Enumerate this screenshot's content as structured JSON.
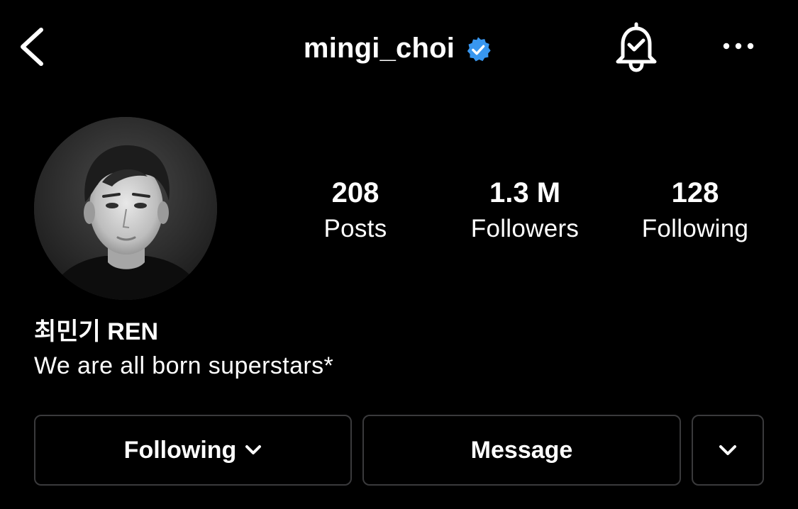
{
  "header": {
    "username": "mingi_choi",
    "verified": true,
    "icons": {
      "back": "chevron-left-icon",
      "verified": "verified-badge-icon",
      "notifications": "bell-check-icon",
      "more": "ellipsis-icon"
    }
  },
  "stats": {
    "posts": {
      "value": "208",
      "label": "Posts"
    },
    "followers": {
      "value": "1.3 M",
      "label": "Followers"
    },
    "following": {
      "value": "128",
      "label": "Following"
    }
  },
  "bio": {
    "display_name": "최민기 REN",
    "text": "We are all born superstars*"
  },
  "actions": {
    "following_label": "Following",
    "message_label": "Message"
  },
  "colors": {
    "background": "#000000",
    "text": "#ffffff",
    "verified": "#3897f0",
    "button_border": "#3a3a3c"
  }
}
